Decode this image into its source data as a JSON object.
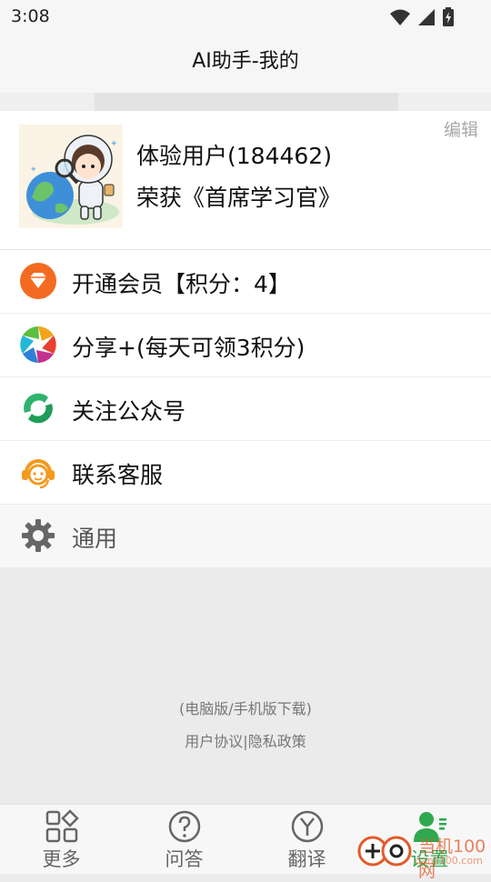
{
  "status": {
    "time": "3:08"
  },
  "header": {
    "title": "AI助手-我的"
  },
  "profile": {
    "username": "体验用户(184462)",
    "honor": "荣获《首席学习官》",
    "edit_label": "编辑"
  },
  "menu": [
    {
      "label": "开通会员【积分：4】",
      "icon": "diamond-icon"
    },
    {
      "label": "分享+(每天可领3积分)",
      "icon": "share-aperture-icon"
    },
    {
      "label": "关注公众号",
      "icon": "follow-account-icon"
    },
    {
      "label": "联系客服",
      "icon": "customer-service-icon"
    },
    {
      "label": "通用",
      "icon": "gear-icon"
    }
  ],
  "footer": {
    "downloads": "(电脑版/手机版下载)",
    "user_agreement": "用户协议",
    "separator": "|",
    "privacy": "隐私政策"
  },
  "tabs": [
    {
      "label": "更多",
      "icon": "grid-icon"
    },
    {
      "label": "问答",
      "icon": "question-icon"
    },
    {
      "label": "翻译",
      "icon": "translate-icon"
    },
    {
      "label": "设置",
      "icon": "user-settings-icon",
      "active": true
    }
  ],
  "watermark": {
    "text": "当机100网",
    "url": "danji100.com"
  },
  "colors": {
    "accent_green": "#2fa84f",
    "orange": "#f36b21"
  }
}
